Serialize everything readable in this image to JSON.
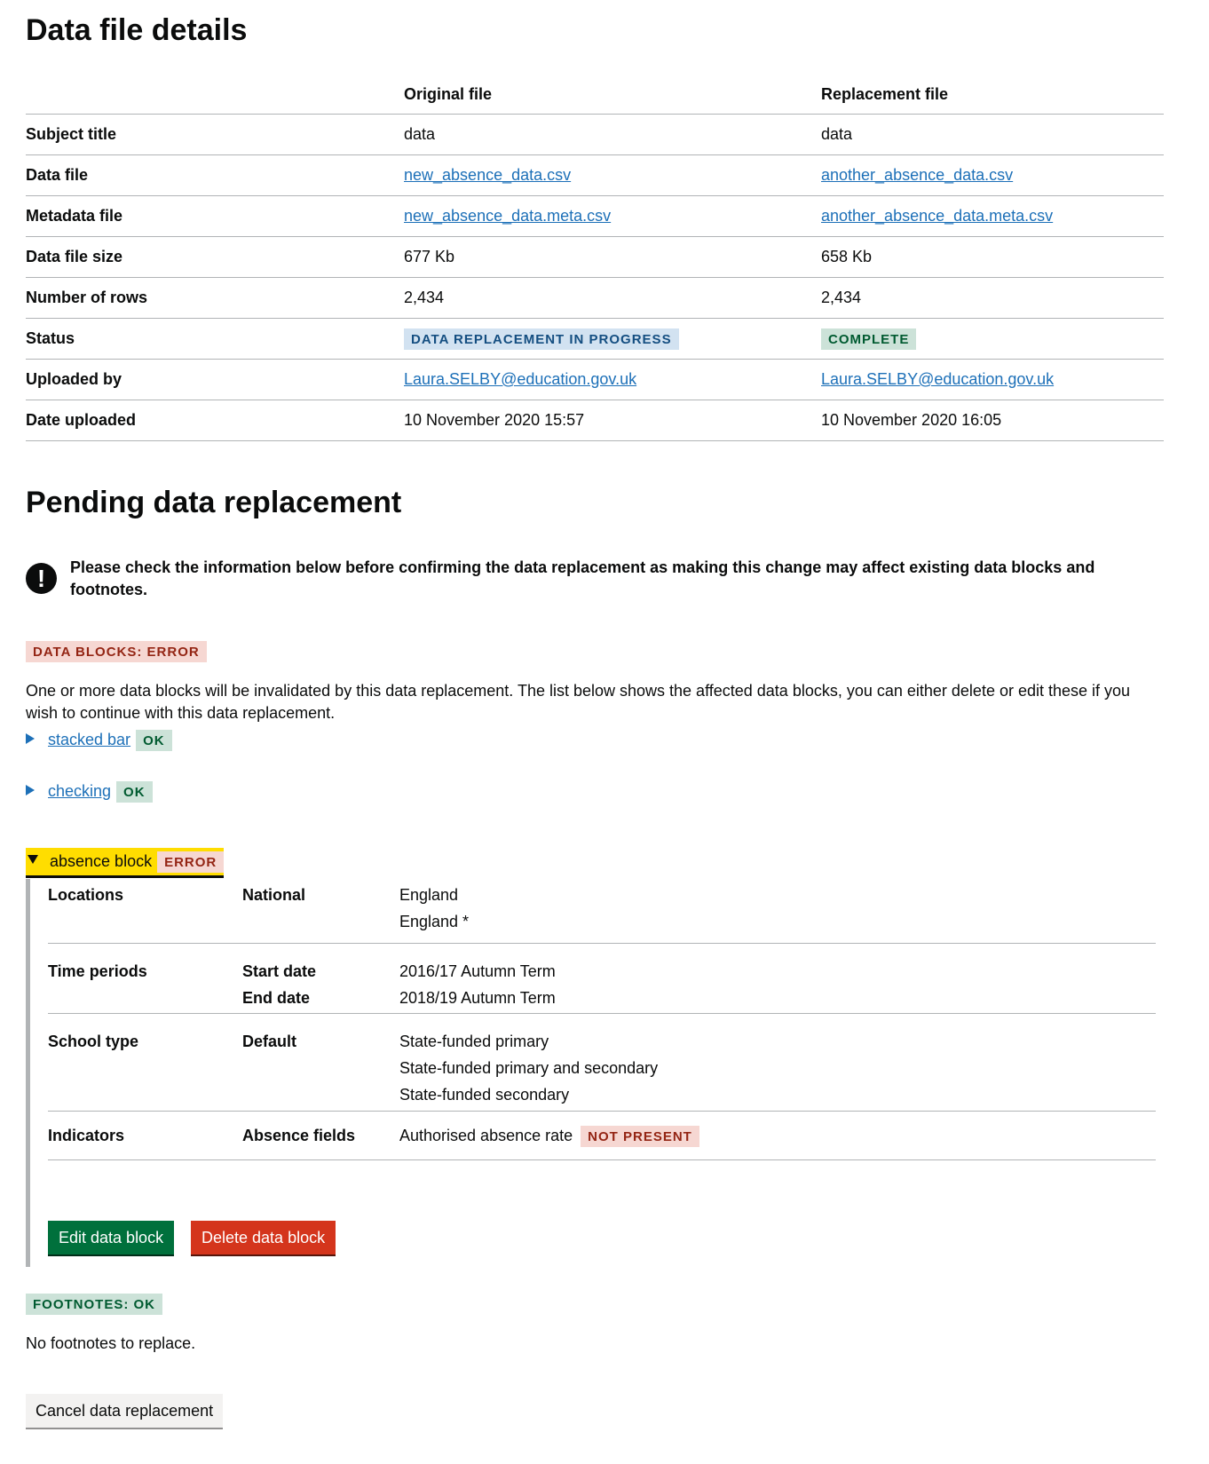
{
  "details": {
    "title": "Data file details",
    "columns": [
      "",
      "Original file",
      "Replacement file"
    ],
    "rows": [
      {
        "label": "Subject title",
        "original": "data",
        "replacement": "data"
      },
      {
        "label": "Data file",
        "original": "new_absence_data.csv",
        "replacement": "another_absence_data.csv"
      },
      {
        "label": "Metadata file",
        "original": "new_absence_data.meta.csv",
        "replacement": "another_absence_data.meta.csv"
      },
      {
        "label": "Data file size",
        "original": "677 Kb",
        "replacement": "658 Kb"
      },
      {
        "label": "Number of rows",
        "original": "2,434",
        "replacement": "2,434"
      },
      {
        "label": "Status",
        "original": "DATA REPLACEMENT IN PROGRESS",
        "replacement": "COMPLETE"
      },
      {
        "label": "Uploaded by",
        "original": "Laura.SELBY@education.gov.uk",
        "replacement": "Laura.SELBY@education.gov.uk"
      },
      {
        "label": "Date uploaded",
        "original": "10 November 2020 15:57",
        "replacement": "10 November 2020 16:05"
      }
    ]
  },
  "pending": {
    "title": "Pending data replacement",
    "warning_icon": "!",
    "warning": "Please check the information below before confirming the data replacement as making this change may affect existing data blocks and footnotes.",
    "blocks_tag": "DATA BLOCKS: ERROR",
    "blocks_description": "One or more data blocks will be invalidated by this data replacement. The list below shows the affected data blocks, you can either delete or edit these if you wish to continue with this data replacement.",
    "blocks": [
      {
        "name": "stacked bar",
        "status": "OK"
      },
      {
        "name": "checking",
        "status": "OK"
      },
      {
        "name": "absence block",
        "status": "ERROR"
      }
    ],
    "open_block": {
      "locations_label": "Locations",
      "locations_level": "National",
      "locations_values": [
        "England",
        "England *"
      ],
      "time_label": "Time periods",
      "start_label": "Start date",
      "end_label": "End date",
      "start_value": "2016/17 Autumn Term",
      "end_value": "2018/19 Autumn Term",
      "school_label": "School type",
      "school_group": "Default",
      "school_values": [
        "State-funded primary",
        "State-funded primary and secondary",
        "State-funded secondary"
      ],
      "indicators_label": "Indicators",
      "indicators_group": "Absence fields",
      "indicator_value": "Authorised absence rate",
      "indicator_status": "NOT PRESENT",
      "edit_button": "Edit data block",
      "delete_button": "Delete data block"
    },
    "footnotes_tag": "FOOTNOTES: OK",
    "footnotes_text": "No footnotes to replace.",
    "cancel_button": "Cancel data replacement"
  },
  "colors": {
    "link": "#1d70b8",
    "focus_yellow": "#ffdd00",
    "green_button": "#00703c",
    "red_button": "#d4351c"
  }
}
